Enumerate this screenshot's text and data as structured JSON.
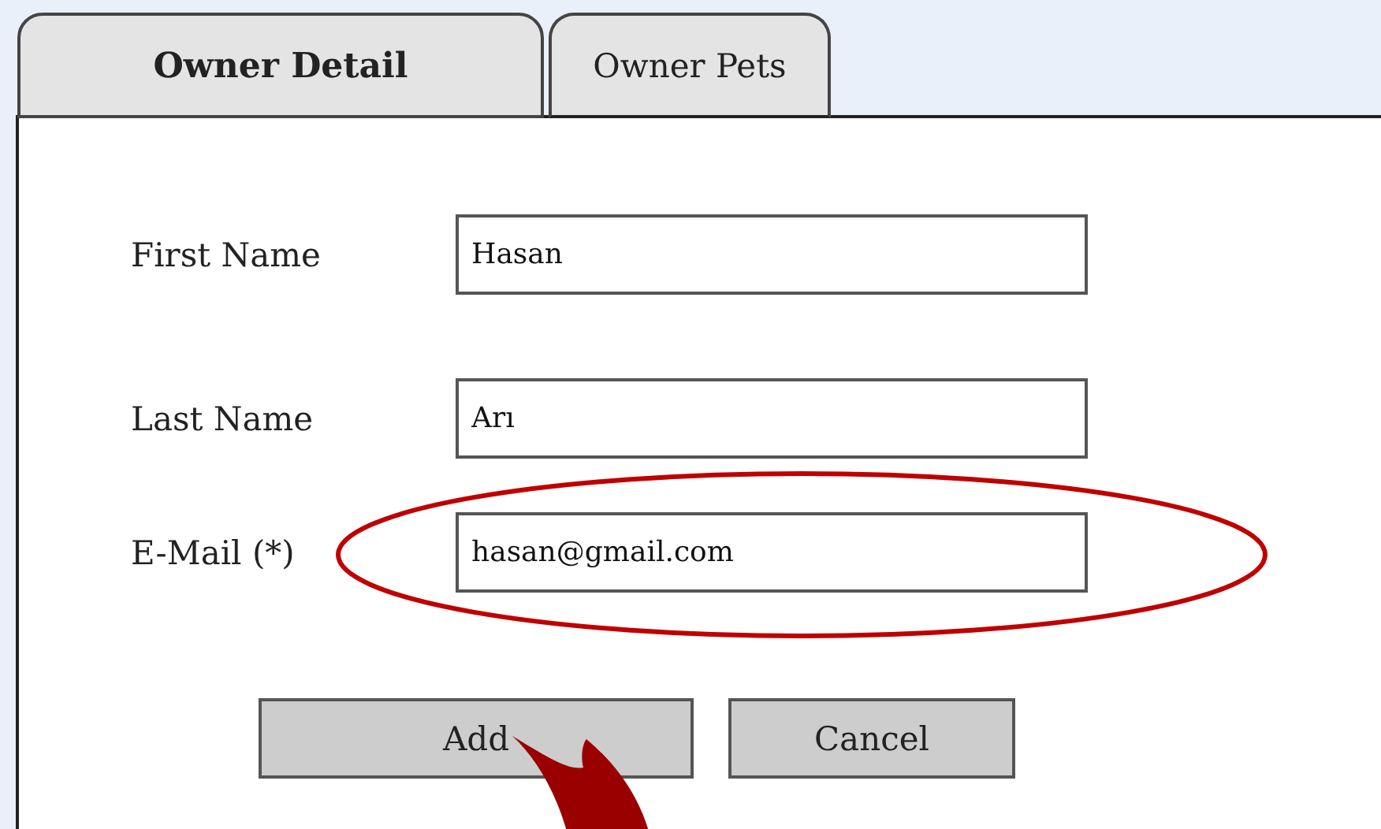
{
  "tabs": [
    {
      "label": "Owner Detail",
      "selected": true
    },
    {
      "label": "Owner Pets",
      "selected": false
    }
  ],
  "fields": [
    {
      "label": "First Name",
      "value": "Hasan",
      "highlighted": false
    },
    {
      "label": "Last Name",
      "value": "Arı",
      "highlighted": false
    },
    {
      "label": "E-Mail (*)",
      "value": "hasan@gmail.com",
      "highlighted": true
    }
  ],
  "buttons": [
    {
      "label": "Add",
      "pointed": true
    },
    {
      "label": "Cancel",
      "pointed": false
    }
  ]
}
